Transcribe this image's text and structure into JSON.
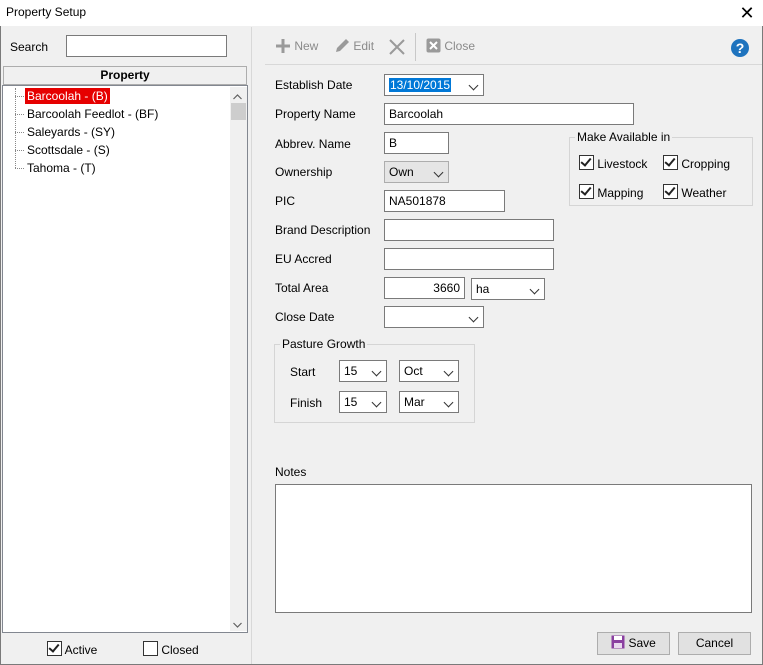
{
  "window": {
    "title": "Property Setup",
    "close_glyph": "✕"
  },
  "left": {
    "search_label": "Search",
    "search_value": "",
    "tree_header": "Property",
    "items": [
      {
        "label": "Barcoolah - (B)",
        "selected": true
      },
      {
        "label": "Barcoolah Feedlot - (BF)"
      },
      {
        "label": "Saleyards - (SY)"
      },
      {
        "label": "Scottsdale - (S)"
      },
      {
        "label": "Tahoma - (T)"
      }
    ],
    "active_label": "Active",
    "active_checked": true,
    "closed_label": "Closed",
    "closed_checked": false
  },
  "toolbar": {
    "new_label": "New",
    "edit_label": "Edit",
    "close_label": "Close",
    "help_glyph": "?"
  },
  "form": {
    "establish_date_label": "Establish Date",
    "establish_date_value": "13/10/2015",
    "property_name_label": "Property Name",
    "property_name_value": "Barcoolah",
    "abbrev_label": "Abbrev. Name",
    "abbrev_value": "B",
    "ownership_label": "Ownership",
    "ownership_value": "Own",
    "pic_label": "PIC",
    "pic_value": "NA501878",
    "brand_label": "Brand Description",
    "brand_value": "",
    "eu_label": "EU Accred",
    "eu_value": "",
    "total_area_label": "Total Area",
    "total_area_value": "3660",
    "area_unit": "ha",
    "close_date_label": "Close Date",
    "close_date_value": "",
    "pasture_title": "Pasture Growth",
    "start_label": "Start",
    "start_day": "15",
    "start_month": "Oct",
    "finish_label": "Finish",
    "finish_day": "15",
    "finish_month": "Mar",
    "notes_label": "Notes",
    "notes_value": ""
  },
  "available": {
    "title": "Make Available in",
    "livestock": "Livestock",
    "cropping": "Cropping",
    "mapping": "Mapping",
    "weather": "Weather"
  },
  "buttons": {
    "save_label": "Save",
    "cancel_label": "Cancel"
  }
}
